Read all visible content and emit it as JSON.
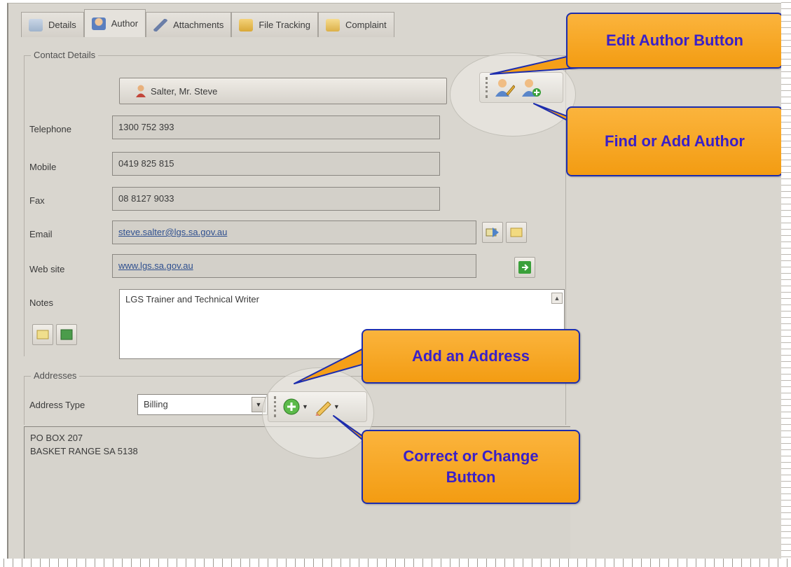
{
  "tabs": [
    {
      "label": "Details",
      "icon": "details-icon",
      "active": false
    },
    {
      "label": "Author",
      "icon": "author-icon",
      "active": true
    },
    {
      "label": "Attachments",
      "icon": "paperclip-icon",
      "active": false
    },
    {
      "label": "File Tracking",
      "icon": "folder-tracking-icon",
      "active": false
    },
    {
      "label": "Complaint",
      "icon": "folder-icon",
      "active": false
    }
  ],
  "contact_details": {
    "legend": "Contact Details",
    "contact_name": "Salter, Mr. Steve",
    "telephone_label": "Telephone",
    "telephone": "1300 752 393",
    "mobile_label": "Mobile",
    "mobile": "0419 825 815",
    "fax_label": "Fax",
    "fax": "08 8127 9033",
    "email_label": "Email",
    "email": "steve.salter@lgs.sa.gov.au",
    "website_label": "Web site",
    "website": "www.lgs.sa.gov.au",
    "notes_label": "Notes",
    "notes": "LGS Trainer and Technical Writer"
  },
  "addresses": {
    "legend": "Addresses",
    "type_label": "Address Type",
    "type_value": "Billing",
    "lines": [
      "PO BOX 207",
      "BASKET RANGE  SA  5138"
    ]
  },
  "callouts": {
    "edit_author": "Edit Author Button",
    "find_add_author": "Find or Add Author",
    "add_address": "Add an Address",
    "correct_change": "Correct or Change Button"
  },
  "colors": {
    "callout_fill": "#f7a823",
    "callout_text": "#3a20c8",
    "callout_border": "#1d2dae",
    "panel_bg": "#d9d6cf"
  }
}
